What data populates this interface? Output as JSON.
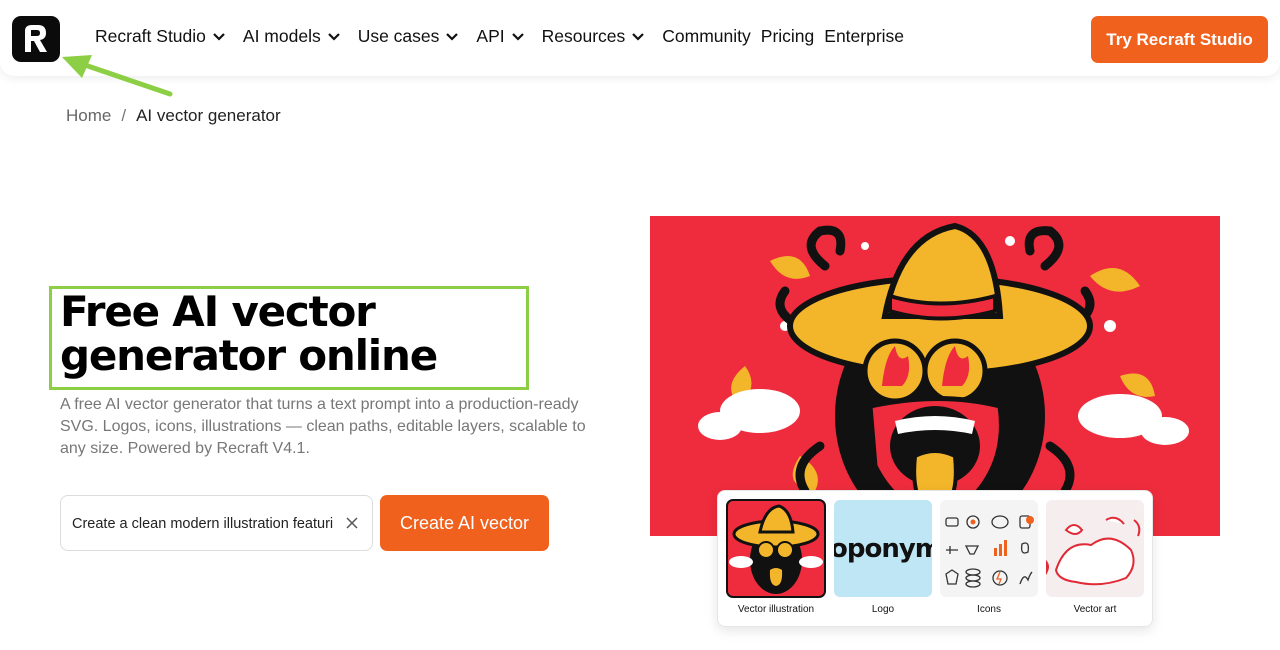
{
  "nav": {
    "items": [
      {
        "label": "Recraft Studio",
        "dropdown": true
      },
      {
        "label": "AI models",
        "dropdown": true
      },
      {
        "label": "Use cases",
        "dropdown": true
      },
      {
        "label": "API",
        "dropdown": true
      },
      {
        "label": "Resources",
        "dropdown": true
      },
      {
        "label": "Community",
        "dropdown": false
      },
      {
        "label": "Pricing",
        "dropdown": false
      },
      {
        "label": "Enterprise",
        "dropdown": false
      }
    ],
    "cta_label": "Try Recraft Studio"
  },
  "breadcrumb": {
    "home": "Home",
    "separator": "/",
    "current": "AI vector generator"
  },
  "hero": {
    "title_line1": "Free AI vector",
    "title_line2": "generator online",
    "subtitle": "A free AI vector generator that turns a text prompt into a production-ready SVG. Logos, icons, illustrations — clean paths, editable layers, scalable to any size. Powered by Recraft V4.1.",
    "prompt_value": "Create a clean modern illustration featuring",
    "create_label": "Create AI vector"
  },
  "styles": [
    {
      "label": "Vector illustration",
      "selected": true
    },
    {
      "label": "Logo",
      "selected": false,
      "thumb_text": "oponym"
    },
    {
      "label": "Icons",
      "selected": false
    },
    {
      "label": "Vector art",
      "selected": false
    }
  ],
  "colors": {
    "accent": "#f0611e",
    "hero_bg": "#ee2c3d",
    "highlight": "#8ccf45",
    "logo_thumb_bg": "#bfe6f5"
  }
}
